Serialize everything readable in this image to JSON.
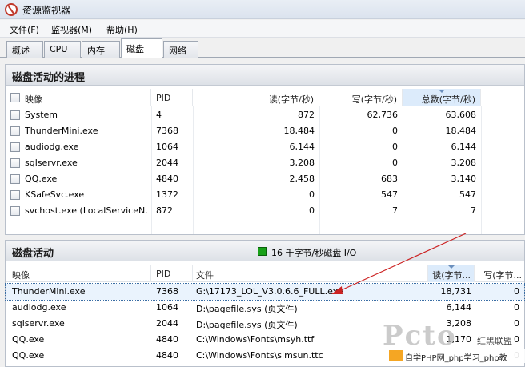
{
  "window": {
    "title": "资源监视器"
  },
  "menu": [
    {
      "label": "文件(F)"
    },
    {
      "label": "监视器(M)"
    },
    {
      "label": "帮助(H)"
    }
  ],
  "tabs": [
    {
      "label": "概述"
    },
    {
      "label": "CPU"
    },
    {
      "label": "内存"
    },
    {
      "label": "磁盘",
      "active": true
    },
    {
      "label": "网络"
    }
  ],
  "processes": {
    "title": "磁盘活动的进程",
    "columns": {
      "image": "映像",
      "pid": "PID",
      "read": "读(字节/秒)",
      "write": "写(字节/秒)",
      "total": "总数(字节/秒)"
    },
    "sorted_column": "total",
    "rows": [
      {
        "image": "System",
        "pid": "4",
        "read": "872",
        "write": "62,736",
        "total": "63,608"
      },
      {
        "image": "ThunderMini.exe",
        "pid": "7368",
        "read": "18,484",
        "write": "0",
        "total": "18,484"
      },
      {
        "image": "audiodg.exe",
        "pid": "1064",
        "read": "6,144",
        "write": "0",
        "total": "6,144"
      },
      {
        "image": "sqlservr.exe",
        "pid": "2044",
        "read": "3,208",
        "write": "0",
        "total": "3,208"
      },
      {
        "image": "QQ.exe",
        "pid": "4840",
        "read": "2,458",
        "write": "683",
        "total": "3,140"
      },
      {
        "image": "KSafeSvc.exe",
        "pid": "1372",
        "read": "0",
        "write": "547",
        "total": "547"
      },
      {
        "image": "svchost.exe (LocalServiceN...",
        "pid": "872",
        "read": "0",
        "write": "7",
        "total": "7"
      }
    ]
  },
  "disk_activity": {
    "title": "磁盘活动",
    "summary": "16 千字节/秒磁盘 I/O",
    "summary_color": "#18a018",
    "columns": {
      "image": "映像",
      "pid": "PID",
      "file": "文件",
      "read": "读(字节...",
      "write": "写(字节..."
    },
    "rows": [
      {
        "image": "ThunderMini.exe",
        "pid": "7368",
        "file": "G:\\17173_LOL_V3.0.6.6_FULL.exe",
        "read": "18,731",
        "write": "0",
        "selected": true
      },
      {
        "image": "audiodg.exe",
        "pid": "1064",
        "file": "D:\\pagefile.sys (页文件)",
        "read": "6,144",
        "write": "0"
      },
      {
        "image": "sqlservr.exe",
        "pid": "2044",
        "file": "D:\\pagefile.sys (页文件)",
        "read": "3,208",
        "write": "0"
      },
      {
        "image": "QQ.exe",
        "pid": "4840",
        "file": "C:\\Windows\\Fonts\\msyh.ttf",
        "read": "1,170",
        "write": "0"
      },
      {
        "image": "QQ.exe",
        "pid": "4840",
        "file": "C:\\Windows\\Fonts\\simsun.ttc",
        "read": "",
        "write": "0"
      }
    ]
  },
  "annotation": {
    "arrow_color": "#cc2222"
  },
  "watermark": {
    "big_text": "Pcto",
    "side_text": "红黑联盟",
    "bar_text": "自学PHP网_php学习_php教"
  }
}
